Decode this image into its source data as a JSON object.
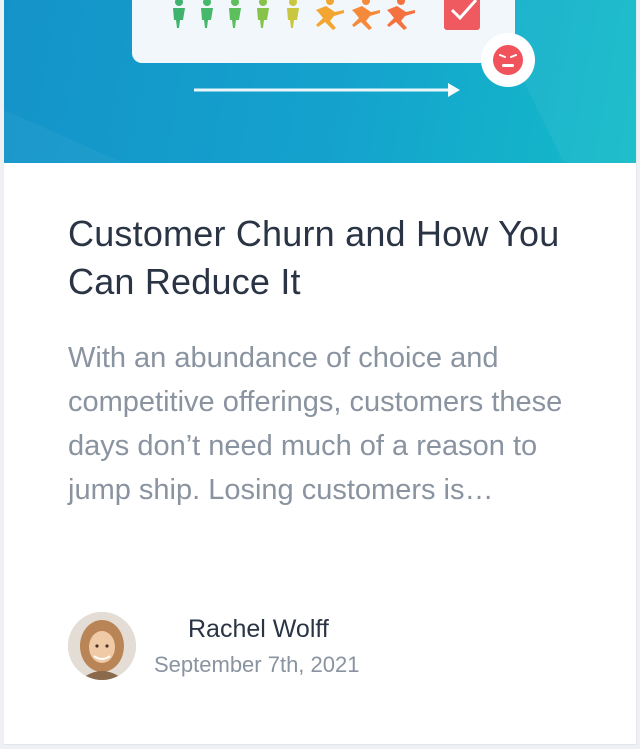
{
  "article": {
    "title": "Customer Churn and How You Can Reduce It",
    "excerpt": "With an abundance of choice and competitive offerings, customers these days don’t need much of a reason to jump ship. Losing customers is…"
  },
  "author": {
    "name": "Rachel Wolff",
    "date": "September 7th, 2021"
  },
  "colors": {
    "hero": "#1499c9",
    "title": "#2a3444",
    "muted": "#8a93a0",
    "alert": "#f1535c"
  },
  "hero_icons": [
    "person-icon",
    "running-person-icon",
    "checkbox-icon",
    "angry-face-icon",
    "arrow-icon"
  ]
}
